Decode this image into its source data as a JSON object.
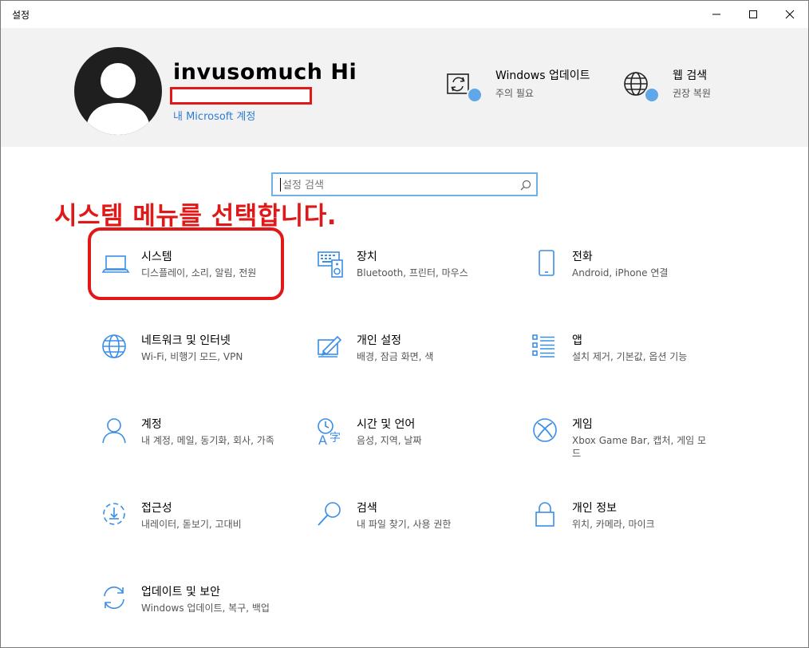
{
  "window": {
    "title": "설정"
  },
  "profile": {
    "username": "invusomuch Hi",
    "ms_account_link": "내 Microsoft 계정"
  },
  "header_quick": [
    {
      "title": "Windows 업데이트",
      "subtitle": "주의 필요",
      "icon": "update-icon"
    },
    {
      "title": "웹 검색",
      "subtitle": "권장 복원",
      "icon": "globe-icon"
    }
  ],
  "search": {
    "placeholder": "설정 검색"
  },
  "annotation": {
    "text": "시스템 메뉴를 선택합니다."
  },
  "tiles": [
    {
      "name": "시스템",
      "desc": "디스플레이, 소리, 알림, 전원",
      "icon": "laptop-icon"
    },
    {
      "name": "장치",
      "desc": "Bluetooth, 프린터, 마우스",
      "icon": "devices-icon"
    },
    {
      "name": "전화",
      "desc": "Android, iPhone 연결",
      "icon": "phone-icon"
    },
    {
      "name": "네트워크 및 인터넷",
      "desc": "Wi-Fi, 비행기 모드, VPN",
      "icon": "network-globe-icon"
    },
    {
      "name": "개인 설정",
      "desc": "배경, 잠금 화면, 색",
      "icon": "personalization-icon"
    },
    {
      "name": "앱",
      "desc": "설치 제거, 기본값, 옵션 기능",
      "icon": "apps-list-icon"
    },
    {
      "name": "계정",
      "desc": "내 계정, 메일, 동기화, 회사, 가족",
      "icon": "person-icon"
    },
    {
      "name": "시간 및 언어",
      "desc": "음성, 지역, 날짜",
      "icon": "time-language-icon"
    },
    {
      "name": "게임",
      "desc": "Xbox Game Bar, 캡처, 게임 모드",
      "icon": "xbox-icon"
    },
    {
      "name": "접근성",
      "desc": "내레이터, 돋보기, 고대비",
      "icon": "ease-of-access-icon"
    },
    {
      "name": "검색",
      "desc": "내 파일 찾기, 사용 권한",
      "icon": "search-magnifier-icon"
    },
    {
      "name": "개인 정보",
      "desc": "위치, 카메라, 마이크",
      "icon": "lock-icon"
    },
    {
      "name": "업데이트 및 보안",
      "desc": "Windows 업데이트, 복구, 백업",
      "icon": "sync-arrows-icon"
    }
  ],
  "colors": {
    "accent": "#0078d7",
    "icon_blue": "#3a8ee6",
    "annotation_red": "#e01818",
    "header_bg": "#f2f2f2"
  }
}
